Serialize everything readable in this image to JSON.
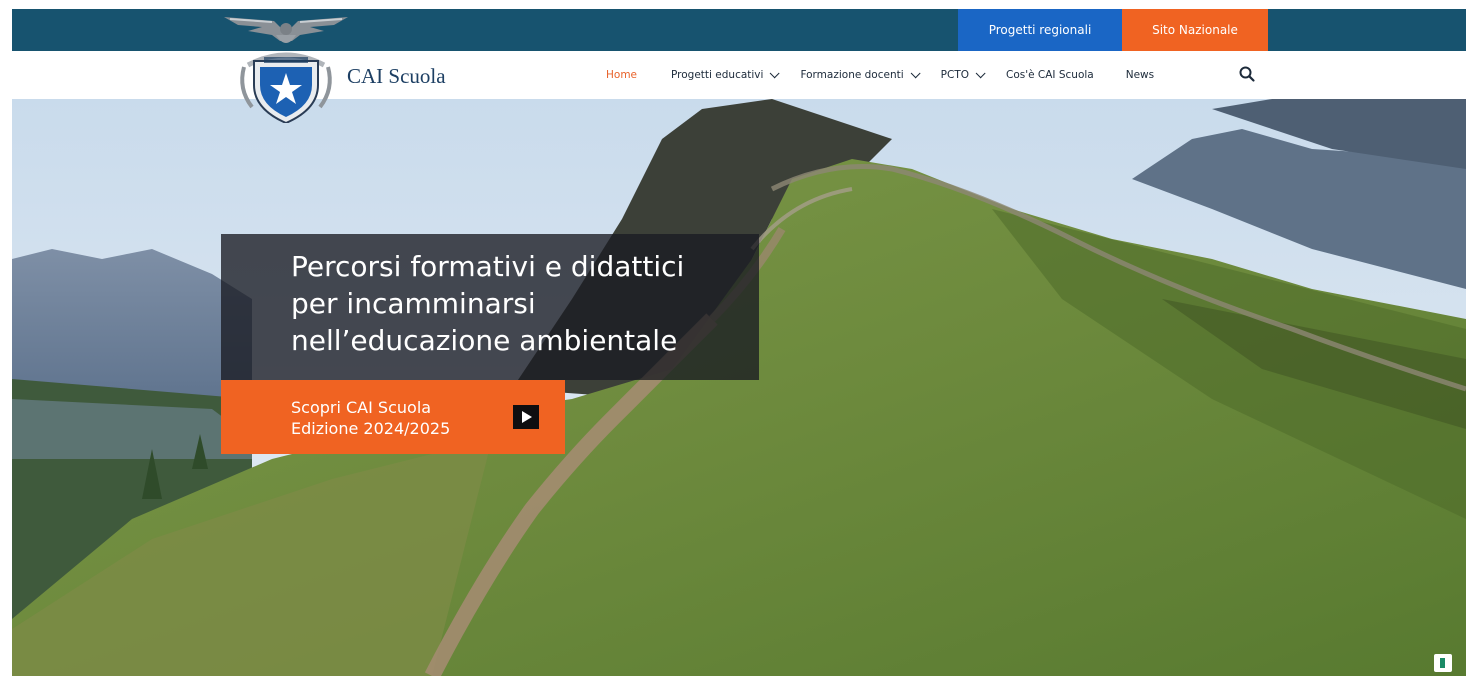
{
  "top_bar": {
    "regional_label": "Progetti regionali",
    "national_label": "Sito Nazionale",
    "bg_color": "#17536f",
    "regional_color": "#1a66c5",
    "national_color": "#f06322"
  },
  "brand": {
    "name": "CAI Scuola",
    "logo_icon": "cai-eagle-shield-logo"
  },
  "nav": {
    "items": [
      {
        "label": "Home",
        "active": true,
        "dropdown": false
      },
      {
        "label": "Progetti educativi",
        "active": false,
        "dropdown": true
      },
      {
        "label": "Formazione docenti",
        "active": false,
        "dropdown": true
      },
      {
        "label": "PCTO",
        "active": false,
        "dropdown": true
      },
      {
        "label": "Cos'è CAI Scuola",
        "active": false,
        "dropdown": false
      },
      {
        "label": "News",
        "active": false,
        "dropdown": false
      }
    ],
    "search_icon": "search-icon",
    "active_color": "#e8622a"
  },
  "hero": {
    "headline_lines": [
      "Percorsi formativi e didattici",
      "per incamminarsi",
      "nell’educazione ambientale"
    ],
    "cta_lines": [
      "Scopri CAI Scuola",
      "Edizione 2024/2025"
    ],
    "cta_icon": "play-icon",
    "cta_color": "#f06322"
  }
}
